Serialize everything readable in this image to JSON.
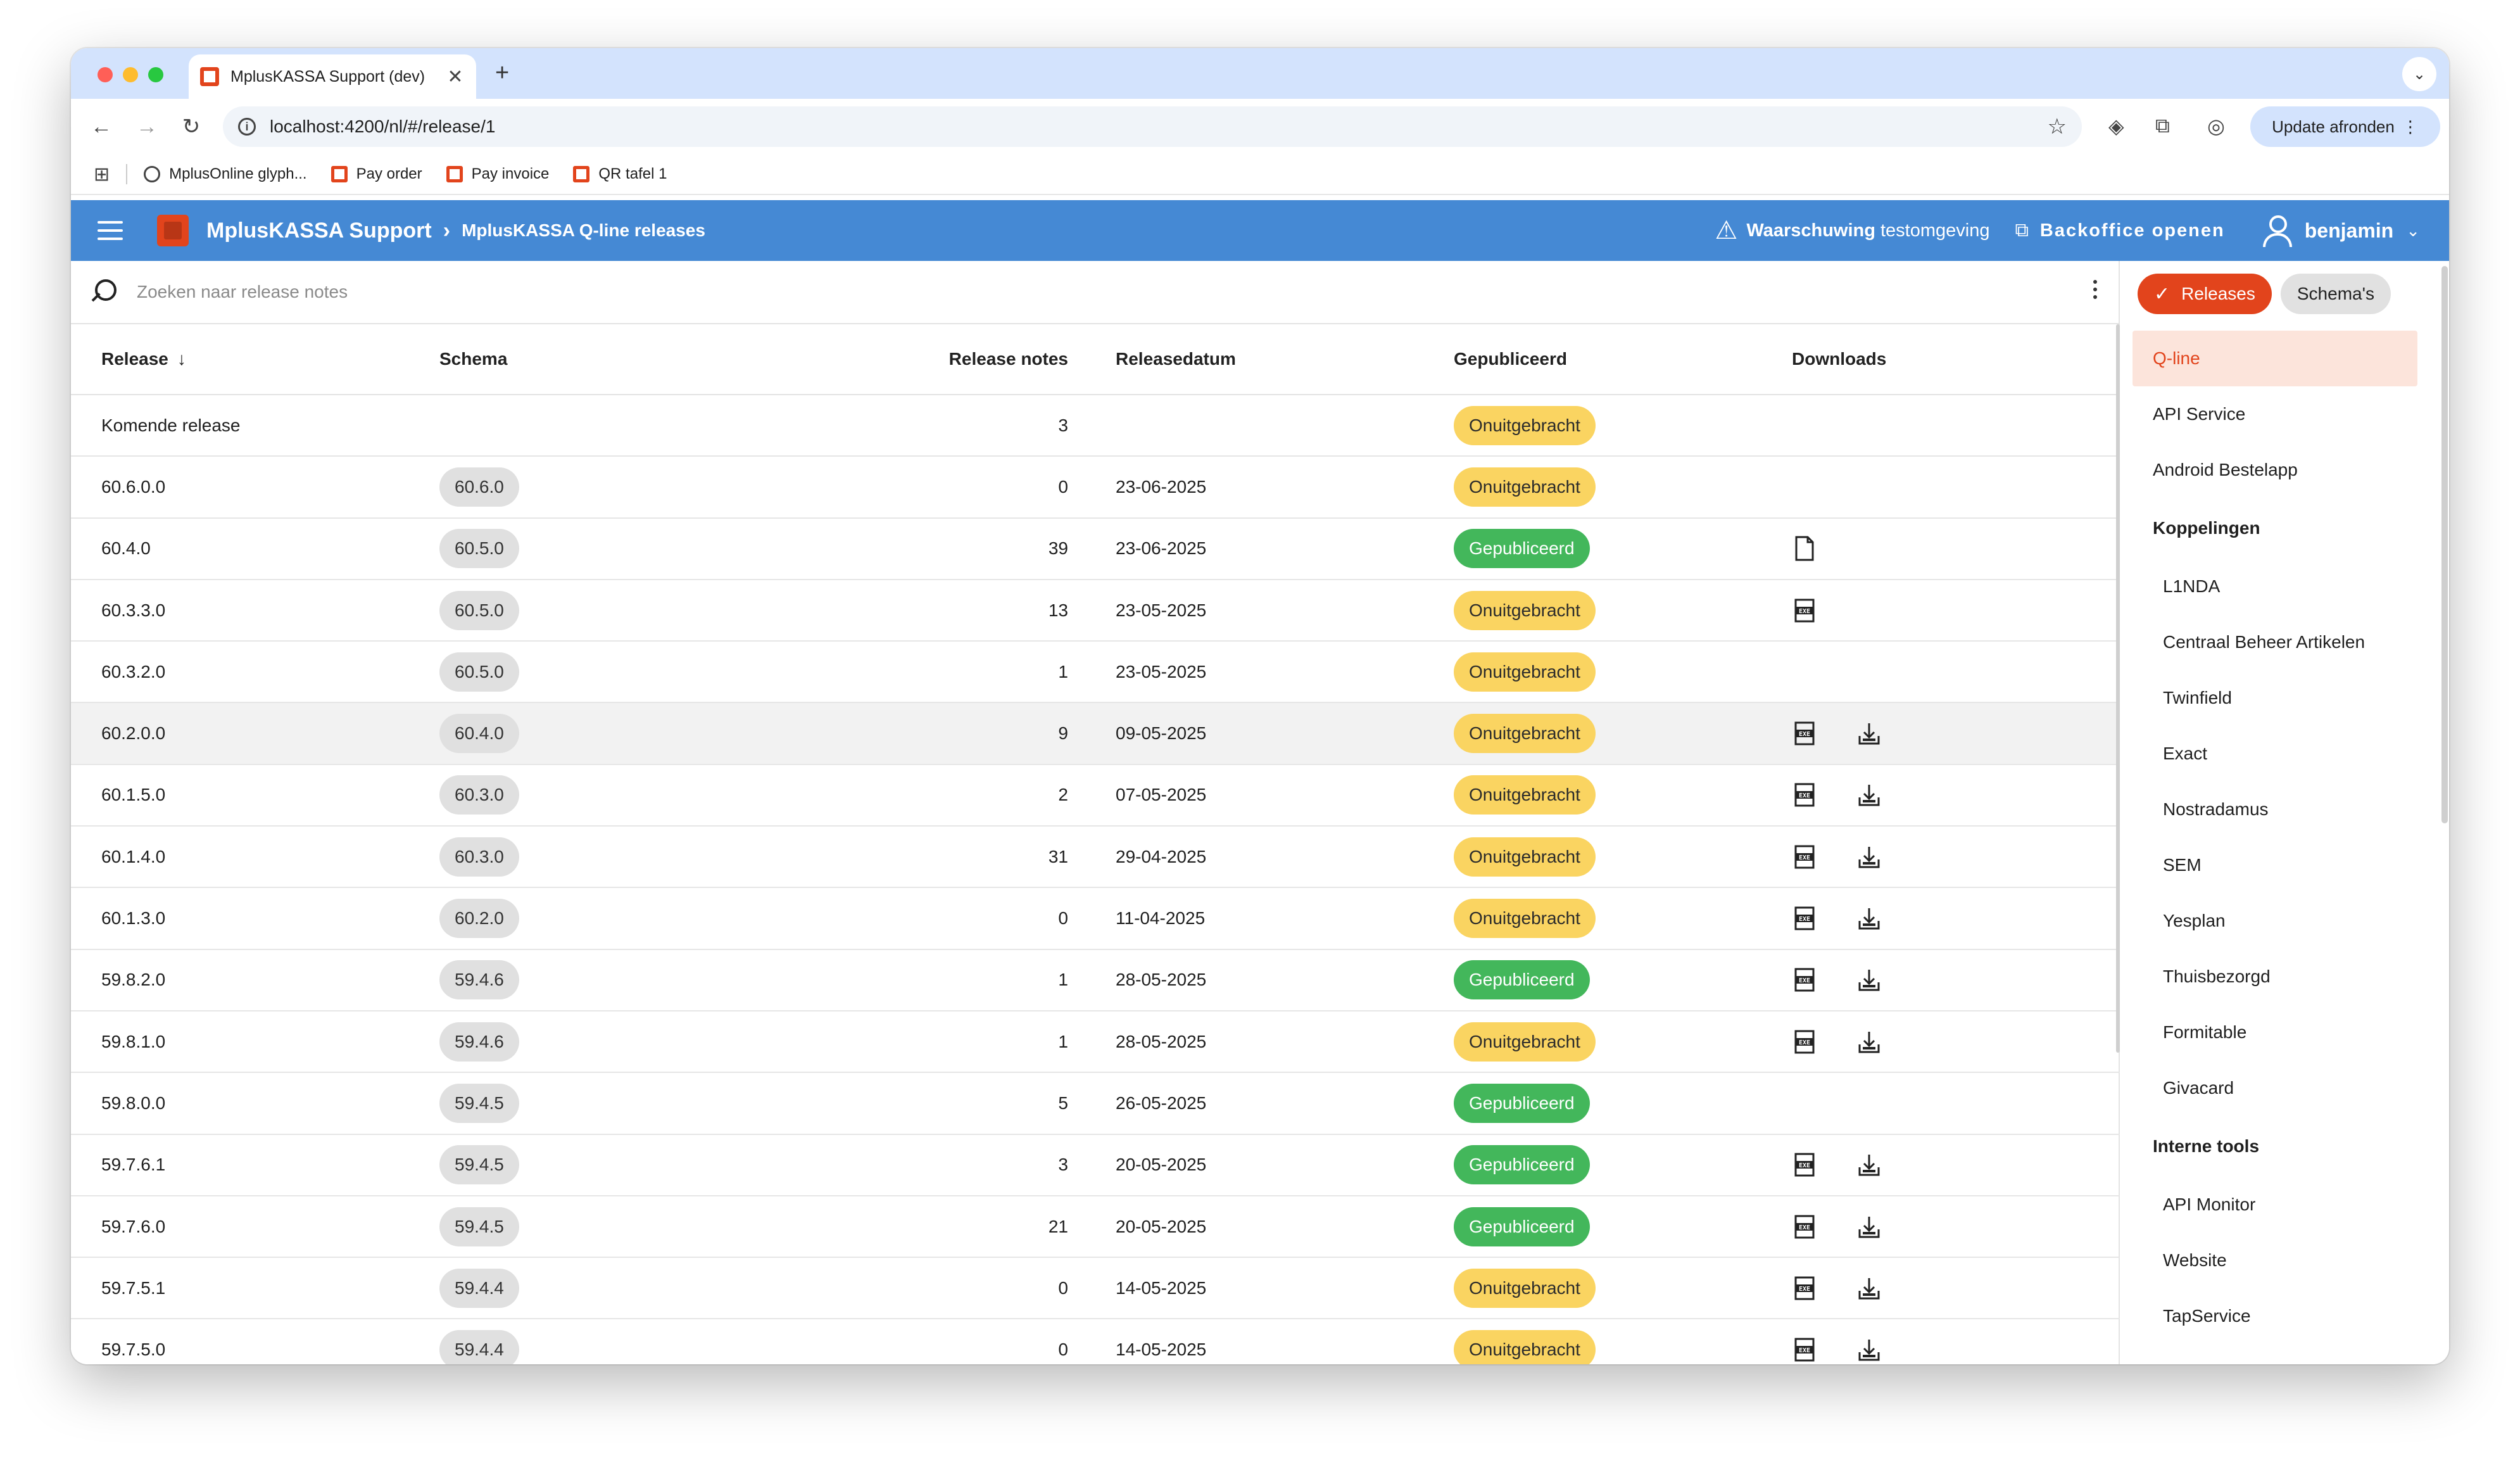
{
  "browser": {
    "tab_title": "MplusKASSA Support (dev)",
    "url": "localhost:4200/nl/#/release/1",
    "update_label": "Update afronden",
    "bookmarks": [
      "MplusOnline glyph...",
      "Pay order",
      "Pay invoice",
      "QR tafel 1"
    ]
  },
  "header": {
    "app_title": "MplusKASSA Support",
    "breadcrumb": "MplusKASSA Q-line releases",
    "warning_strong": "Waarschuwing",
    "warning_text": "testomgeving",
    "backoffice_label": "Backoffice openen",
    "user_name": "benjamin"
  },
  "search": {
    "placeholder": "Zoeken naar release notes"
  },
  "table": {
    "columns": [
      "Release",
      "Schema",
      "Release notes",
      "Releasedatum",
      "Gepubliceerd",
      "Downloads"
    ],
    "rows": [
      {
        "release": "Komende release",
        "schema": "",
        "notes": "3",
        "date": "",
        "status": "Onuitgebracht",
        "published": false,
        "downloads": []
      },
      {
        "release": "60.6.0.0",
        "schema": "60.6.0",
        "notes": "0",
        "date": "23-06-2025",
        "status": "Onuitgebracht",
        "published": false,
        "downloads": []
      },
      {
        "release": "60.4.0",
        "schema": "60.5.0",
        "notes": "39",
        "date": "23-06-2025",
        "status": "Gepubliceerd",
        "published": true,
        "downloads": [
          "file"
        ]
      },
      {
        "release": "60.3.3.0",
        "schema": "60.5.0",
        "notes": "13",
        "date": "23-05-2025",
        "status": "Onuitgebracht",
        "published": false,
        "downloads": [
          "exe"
        ]
      },
      {
        "release": "60.3.2.0",
        "schema": "60.5.0",
        "notes": "1",
        "date": "23-05-2025",
        "status": "Onuitgebracht",
        "published": false,
        "downloads": []
      },
      {
        "release": "60.2.0.0",
        "schema": "60.4.0",
        "notes": "9",
        "date": "09-05-2025",
        "status": "Onuitgebracht",
        "published": false,
        "downloads": [
          "exe",
          "installer"
        ]
      },
      {
        "release": "60.1.5.0",
        "schema": "60.3.0",
        "notes": "2",
        "date": "07-05-2025",
        "status": "Onuitgebracht",
        "published": false,
        "downloads": [
          "exe",
          "installer"
        ]
      },
      {
        "release": "60.1.4.0",
        "schema": "60.3.0",
        "notes": "31",
        "date": "29-04-2025",
        "status": "Onuitgebracht",
        "published": false,
        "downloads": [
          "exe",
          "installer"
        ]
      },
      {
        "release": "60.1.3.0",
        "schema": "60.2.0",
        "notes": "0",
        "date": "11-04-2025",
        "status": "Onuitgebracht",
        "published": false,
        "downloads": [
          "exe",
          "installer"
        ]
      },
      {
        "release": "59.8.2.0",
        "schema": "59.4.6",
        "notes": "1",
        "date": "28-05-2025",
        "status": "Gepubliceerd",
        "published": true,
        "downloads": [
          "exe",
          "installer"
        ]
      },
      {
        "release": "59.8.1.0",
        "schema": "59.4.6",
        "notes": "1",
        "date": "28-05-2025",
        "status": "Onuitgebracht",
        "published": false,
        "downloads": [
          "exe",
          "installer"
        ]
      },
      {
        "release": "59.8.0.0",
        "schema": "59.4.5",
        "notes": "5",
        "date": "26-05-2025",
        "status": "Gepubliceerd",
        "published": true,
        "downloads": []
      },
      {
        "release": "59.7.6.1",
        "schema": "59.4.5",
        "notes": "3",
        "date": "20-05-2025",
        "status": "Gepubliceerd",
        "published": true,
        "downloads": [
          "exe",
          "installer"
        ]
      },
      {
        "release": "59.7.6.0",
        "schema": "59.4.5",
        "notes": "21",
        "date": "20-05-2025",
        "status": "Gepubliceerd",
        "published": true,
        "downloads": [
          "exe",
          "installer"
        ]
      },
      {
        "release": "59.7.5.1",
        "schema": "59.4.4",
        "notes": "0",
        "date": "14-05-2025",
        "status": "Onuitgebracht",
        "published": false,
        "downloads": [
          "exe",
          "installer"
        ]
      },
      {
        "release": "59.7.5.0",
        "schema": "59.4.4",
        "notes": "0",
        "date": "14-05-2025",
        "status": "Onuitgebracht",
        "published": false,
        "downloads": [
          "exe",
          "installer"
        ]
      }
    ]
  },
  "side": {
    "toggle_active": "Releases",
    "toggle_inactive": "Schema's",
    "items": [
      "Q-line",
      "API Service",
      "Android Bestelapp"
    ],
    "groups": [
      {
        "title": "Koppelingen",
        "items": [
          "L1NDA",
          "Centraal Beheer Artikelen",
          "Twinfield",
          "Exact",
          "Nostradamus",
          "SEM",
          "Yesplan",
          "Thuisbezorgd",
          "Formitable",
          "Givacard"
        ]
      },
      {
        "title": "Interne tools",
        "items": [
          "API Monitor",
          "Website",
          "TapService"
        ]
      }
    ]
  },
  "colors": {
    "brand": "#e2441c",
    "appbar": "#4589d4",
    "published": "#43b75b",
    "unpublished": "#fad461"
  }
}
